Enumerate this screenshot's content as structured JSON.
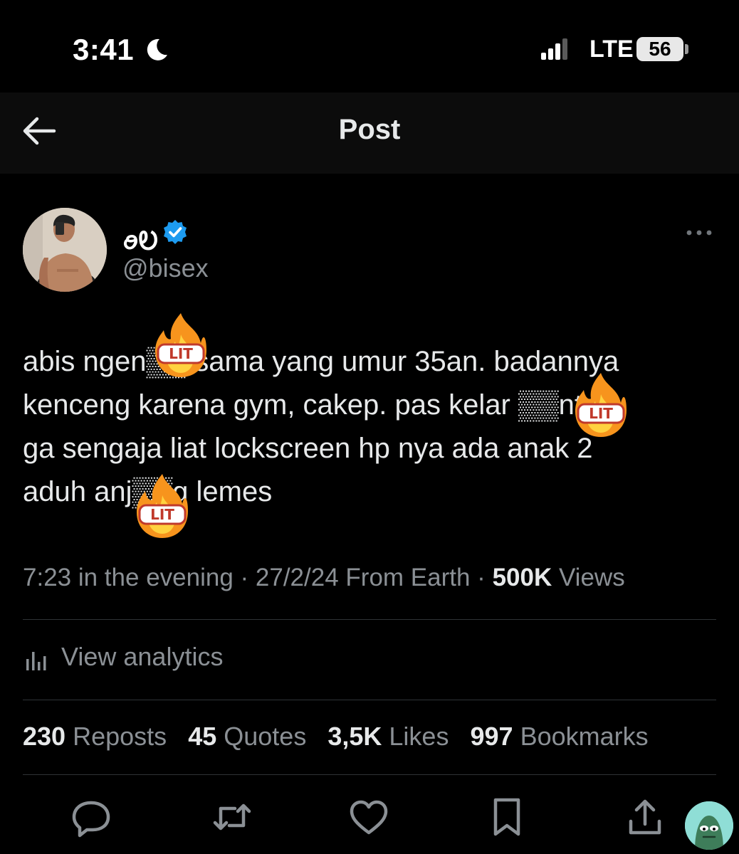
{
  "status_bar": {
    "time": "3:41",
    "network": "LTE",
    "battery": "56"
  },
  "header": {
    "title": "Post"
  },
  "author": {
    "name": "ꪮᎧ",
    "handle": "@bisex"
  },
  "tweet": {
    "lines": [
      "abis ngen▒▒ sama yang umur 35an. badannya",
      "kenceng karena gym, cakep. pas kelar ▒▒ntot",
      "ga sengaja liat lockscreen hp nya ada anak 2",
      "aduh anj▒▒g lemes"
    ],
    "sticker_label": "LIT"
  },
  "meta": {
    "time": "7:23 in the evening",
    "sep1": " · ",
    "date_location": "27/2/24 From Earth",
    "sep2": " · ",
    "views_count": "500K",
    "views_label": "Views"
  },
  "analytics": {
    "label": "View analytics"
  },
  "stats": {
    "reposts_count": "230",
    "reposts_label": "Reposts",
    "quotes_count": "45",
    "quotes_label": "Quotes",
    "likes_count": "3,5K",
    "likes_label": "Likes",
    "bookmarks_count": "997",
    "bookmarks_label": "Bookmarks"
  },
  "colors": {
    "background": "#000000",
    "header_bg": "#0c0c0c",
    "primary_text": "#e7e9ea",
    "secondary_text": "#8b9095",
    "verified_blue": "#1d9bf0",
    "divider": "#2f3336"
  },
  "icons": [
    "moon-icon",
    "signal-icon",
    "back-arrow-icon",
    "verified-badge-icon",
    "more-icon",
    "fire-sticker-icon",
    "analytics-icon",
    "reply-icon",
    "repost-icon",
    "like-icon",
    "bookmark-icon",
    "share-icon"
  ]
}
